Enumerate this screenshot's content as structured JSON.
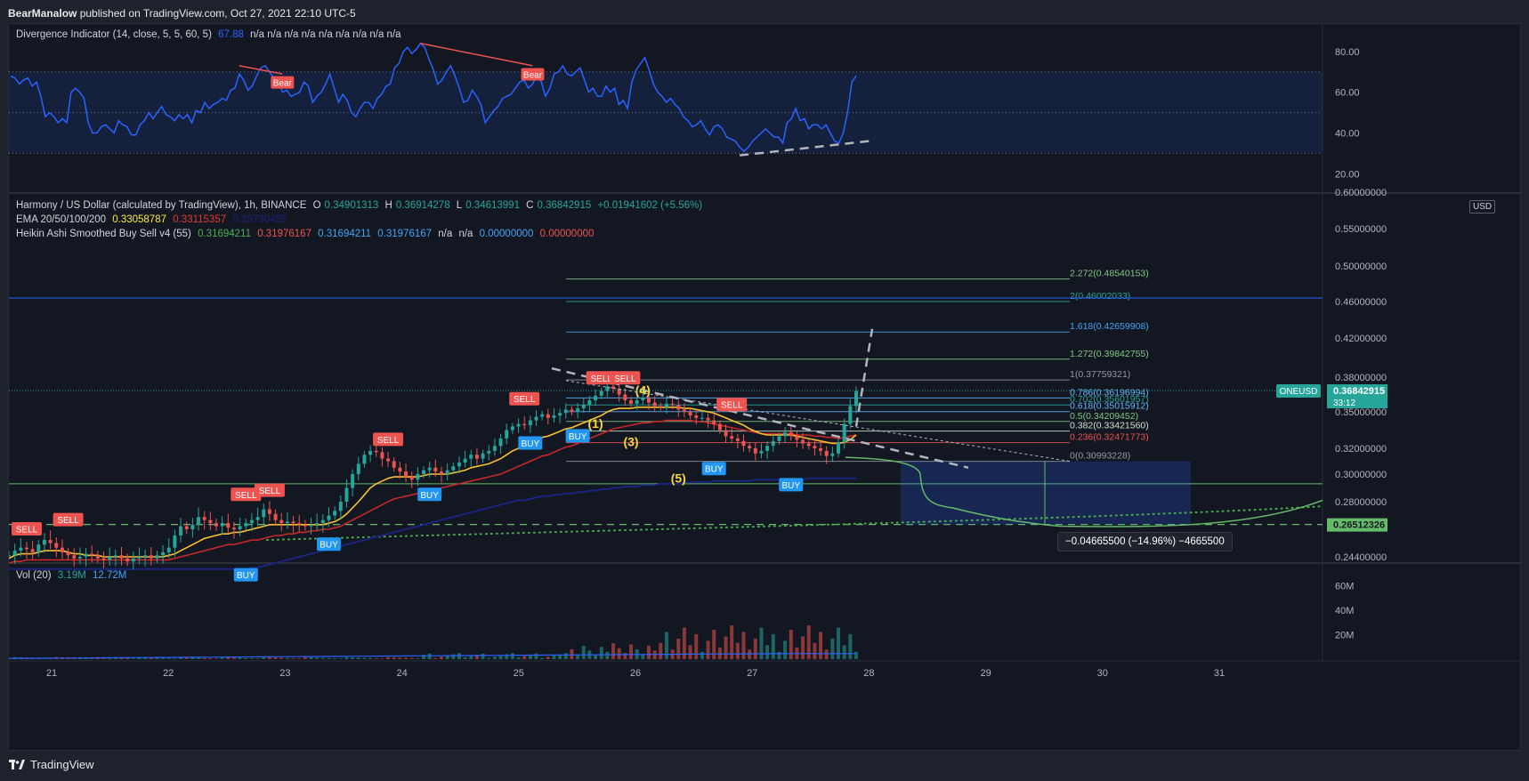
{
  "header": {
    "author": "BearManalow",
    "published": "published on TradingView.com, Oct 27, 2021 22:10 UTC-5"
  },
  "footer": {
    "brand": "TradingView"
  },
  "chart_data": [
    {
      "type": "line",
      "name": "Divergence Indicator",
      "legend": {
        "label": "Divergence Indicator (14, close, 5, 5, 60, 5)",
        "value": "67.88",
        "na": "n/a  n/a  n/a  n/a  n/a  n/a  n/a  n/a  n/a"
      },
      "y_ticks": [
        "80.00",
        "60.00",
        "40.00",
        "20.00"
      ],
      "ylim": [
        14,
        90
      ],
      "band": [
        30,
        70
      ],
      "midline": 50,
      "values": [
        68,
        67,
        64,
        66,
        67,
        63,
        65,
        58,
        48,
        50,
        48,
        45,
        47,
        45,
        60,
        62,
        60,
        57,
        45,
        40,
        40,
        43,
        44,
        42,
        40,
        46,
        44,
        43,
        39,
        39,
        44,
        46,
        50,
        47,
        50,
        53,
        49,
        48,
        46,
        49,
        47,
        49,
        45,
        51,
        50,
        55,
        52,
        54,
        55,
        57,
        56,
        61,
        62,
        69,
        66,
        61,
        63,
        68,
        72,
        73,
        70,
        67,
        66,
        60,
        61,
        58,
        59,
        60,
        65,
        63,
        55,
        58,
        60,
        64,
        69,
        62,
        55,
        59,
        56,
        50,
        48,
        52,
        55,
        55,
        52,
        57,
        59,
        63,
        64,
        72,
        74,
        80,
        82,
        79,
        81,
        84,
        82,
        76,
        71,
        64,
        66,
        70,
        73,
        68,
        62,
        55,
        56,
        61,
        58,
        54,
        45,
        48,
        51,
        53,
        57,
        58,
        59,
        62,
        65,
        66,
        62,
        64,
        69,
        65,
        58,
        62,
        69,
        70,
        73,
        69,
        68,
        70,
        72,
        66,
        60,
        62,
        58,
        58,
        63,
        60,
        62,
        54,
        56,
        52,
        65,
        71,
        74,
        77,
        71,
        64,
        60,
        58,
        55,
        57,
        54,
        52,
        48,
        46,
        43,
        44,
        46,
        42,
        39,
        43,
        44,
        42,
        38,
        37,
        36,
        33,
        31,
        33,
        36,
        38,
        40,
        42,
        40,
        38,
        38,
        35,
        45,
        47,
        52,
        46,
        47,
        42,
        44,
        44,
        42,
        44,
        40,
        36,
        35,
        40,
        50,
        65,
        68
      ],
      "annotations": [
        {
          "label": "Bear",
          "x_index": 63
        },
        {
          "label": "Bear",
          "x_index": 121
        }
      ]
    },
    {
      "type": "candlestick",
      "name": "Harmony / US Dollar",
      "legend": {
        "title": "Harmony / US Dollar (calculated by TradingView), 1h, BINANCE",
        "O": "0.34901313",
        "H": "0.36914278",
        "L": "0.34613991",
        "C": "0.36842915",
        "change": "+0.01941602 (+5.56%)",
        "ema_label": "EMA 20/50/100/200",
        "ema_values": [
          "0.33058787",
          "0.33115357",
          "0.28730455"
        ],
        "ha_label": "Heikin Ashi Smoothed Buy Sell v4  (55)",
        "ha_values": [
          "0.31694211",
          "0.31976167",
          "0.31694211",
          "0.31976167",
          "n/a",
          "n/a",
          "0.00000000",
          "0.00000000"
        ]
      },
      "y_ticks": [
        "0.60000000",
        "0.55000000",
        "0.50000000",
        "0.46000000",
        "0.42000000",
        "0.38000000",
        "0.35000000",
        "0.32000000",
        "0.30000000",
        "0.28000000",
        "0.24400000"
      ],
      "currency": "USD",
      "x_ticks": [
        "21",
        "22",
        "23",
        "24",
        "25",
        "26",
        "27",
        "28",
        "29",
        "30",
        "31"
      ],
      "last_price": {
        "symbol": "ONEUSD",
        "price": "0.36842915",
        "countdown": "33:12"
      },
      "target_price": "0.26512326",
      "close": [
        0.245,
        0.248,
        0.25,
        0.249,
        0.247,
        0.252,
        0.255,
        0.253,
        0.25,
        0.247,
        0.245,
        0.243,
        0.244,
        0.246,
        0.245,
        0.243,
        0.242,
        0.244,
        0.245,
        0.243,
        0.241,
        0.243,
        0.244,
        0.245,
        0.243,
        0.245,
        0.247,
        0.25,
        0.258,
        0.264,
        0.262,
        0.265,
        0.27,
        0.268,
        0.266,
        0.264,
        0.266,
        0.263,
        0.262,
        0.264,
        0.266,
        0.268,
        0.27,
        0.275,
        0.272,
        0.268,
        0.266,
        0.267,
        0.266,
        0.265,
        0.264,
        0.265,
        0.266,
        0.268,
        0.271,
        0.274,
        0.28,
        0.29,
        0.3,
        0.308,
        0.315,
        0.318,
        0.317,
        0.312,
        0.31,
        0.305,
        0.302,
        0.298,
        0.296,
        0.3,
        0.303,
        0.305,
        0.302,
        0.3,
        0.303,
        0.306,
        0.309,
        0.312,
        0.315,
        0.312,
        0.316,
        0.318,
        0.322,
        0.328,
        0.335,
        0.338,
        0.34,
        0.339,
        0.343,
        0.346,
        0.348,
        0.345,
        0.347,
        0.349,
        0.352,
        0.35,
        0.353,
        0.356,
        0.36,
        0.364,
        0.368,
        0.372,
        0.37,
        0.365,
        0.36,
        0.357,
        0.36,
        0.362,
        0.358,
        0.355,
        0.354,
        0.357,
        0.356,
        0.352,
        0.35,
        0.347,
        0.345,
        0.345,
        0.343,
        0.34,
        0.335,
        0.33,
        0.328,
        0.326,
        0.322,
        0.32,
        0.316,
        0.318,
        0.322,
        0.326,
        0.33,
        0.333,
        0.33,
        0.327,
        0.324,
        0.322,
        0.32,
        0.318,
        0.314,
        0.316,
        0.325,
        0.34,
        0.355,
        0.368
      ],
      "ema_fast": [
        0.243,
        0.245,
        0.246,
        0.246,
        0.246,
        0.247,
        0.248,
        0.248,
        0.248,
        0.248,
        0.247,
        0.246,
        0.246,
        0.245,
        0.245,
        0.245,
        0.244,
        0.244,
        0.244,
        0.244,
        0.244,
        0.244,
        0.244,
        0.244,
        0.244,
        0.244,
        0.244,
        0.245,
        0.246,
        0.248,
        0.25,
        0.252,
        0.254,
        0.256,
        0.257,
        0.258,
        0.259,
        0.259,
        0.26,
        0.26,
        0.261,
        0.262,
        0.263,
        0.264,
        0.265,
        0.265,
        0.265,
        0.265,
        0.265,
        0.265,
        0.265,
        0.265,
        0.265,
        0.265,
        0.266,
        0.267,
        0.269,
        0.272,
        0.276,
        0.28,
        0.285,
        0.29,
        0.293,
        0.295,
        0.297,
        0.298,
        0.298,
        0.298,
        0.298,
        0.298,
        0.299,
        0.3,
        0.3,
        0.3,
        0.3,
        0.301,
        0.302,
        0.303,
        0.305,
        0.306,
        0.307,
        0.308,
        0.31,
        0.312,
        0.315,
        0.318,
        0.32,
        0.322,
        0.324,
        0.327,
        0.329,
        0.33,
        0.332,
        0.334,
        0.336,
        0.337,
        0.339,
        0.341,
        0.343,
        0.345,
        0.347,
        0.35,
        0.352,
        0.353,
        0.353,
        0.353,
        0.354,
        0.354,
        0.354,
        0.354,
        0.354,
        0.354,
        0.354,
        0.354,
        0.353,
        0.353,
        0.352,
        0.351,
        0.35,
        0.349,
        0.347,
        0.345,
        0.343,
        0.341,
        0.339,
        0.336,
        0.334,
        0.332,
        0.331,
        0.331,
        0.331,
        0.331,
        0.331,
        0.33,
        0.329,
        0.328,
        0.327,
        0.326,
        0.325,
        0.324,
        0.324,
        0.325,
        0.327,
        0.331
      ],
      "ema_mid": [
        0.24,
        0.241,
        0.241,
        0.242,
        0.242,
        0.242,
        0.242,
        0.242,
        0.242,
        0.242,
        0.242,
        0.242,
        0.242,
        0.242,
        0.242,
        0.242,
        0.242,
        0.242,
        0.242,
        0.242,
        0.242,
        0.242,
        0.242,
        0.242,
        0.242,
        0.242,
        0.242,
        0.242,
        0.243,
        0.244,
        0.245,
        0.246,
        0.247,
        0.248,
        0.249,
        0.25,
        0.251,
        0.252,
        0.252,
        0.253,
        0.254,
        0.255,
        0.255,
        0.256,
        0.257,
        0.258,
        0.258,
        0.259,
        0.259,
        0.26,
        0.26,
        0.261,
        0.261,
        0.262,
        0.262,
        0.263,
        0.264,
        0.266,
        0.268,
        0.27,
        0.272,
        0.274,
        0.276,
        0.278,
        0.28,
        0.282,
        0.283,
        0.284,
        0.285,
        0.286,
        0.287,
        0.288,
        0.289,
        0.29,
        0.291,
        0.292,
        0.293,
        0.294,
        0.295,
        0.296,
        0.297,
        0.298,
        0.299,
        0.3,
        0.302,
        0.304,
        0.306,
        0.308,
        0.31,
        0.312,
        0.314,
        0.315,
        0.317,
        0.319,
        0.321,
        0.322,
        0.324,
        0.326,
        0.328,
        0.33,
        0.332,
        0.334,
        0.336,
        0.337,
        0.338,
        0.339,
        0.34,
        0.341,
        0.341,
        0.342,
        0.342,
        0.343,
        0.343,
        0.343,
        0.343,
        0.343,
        0.342,
        0.342,
        0.341,
        0.34,
        0.339,
        0.338,
        0.337,
        0.336,
        0.335,
        0.334,
        0.333,
        0.332,
        0.332,
        0.332,
        0.332,
        0.332,
        0.332,
        0.331,
        0.331,
        0.331,
        0.33,
        0.33,
        0.329,
        0.329,
        0.328,
        0.329,
        0.33,
        0.331
      ],
      "ema_slow": [
        0.236,
        0.236,
        0.236,
        0.236,
        0.236,
        0.236,
        0.236,
        0.236,
        0.236,
        0.236,
        0.236,
        0.236,
        0.236,
        0.236,
        0.236,
        0.236,
        0.236,
        0.236,
        0.236,
        0.236,
        0.236,
        0.236,
        0.236,
        0.236,
        0.236,
        0.236,
        0.236,
        0.236,
        0.236,
        0.236,
        0.236,
        0.236,
        0.236,
        0.236,
        0.236,
        0.236,
        0.236,
        0.236,
        0.236,
        0.236,
        0.236,
        0.237,
        0.237,
        0.238,
        0.239,
        0.24,
        0.241,
        0.242,
        0.243,
        0.244,
        0.245,
        0.246,
        0.247,
        0.248,
        0.249,
        0.25,
        0.251,
        0.252,
        0.253,
        0.254,
        0.255,
        0.256,
        0.257,
        0.258,
        0.259,
        0.26,
        0.261,
        0.262,
        0.263,
        0.264,
        0.265,
        0.266,
        0.267,
        0.268,
        0.269,
        0.27,
        0.271,
        0.272,
        0.273,
        0.274,
        0.275,
        0.276,
        0.277,
        0.278,
        0.279,
        0.28,
        0.281,
        0.281,
        0.282,
        0.283,
        0.284,
        0.284,
        0.285,
        0.285,
        0.286,
        0.286,
        0.287,
        0.287,
        0.288,
        0.288,
        0.289,
        0.289,
        0.29,
        0.29,
        0.291,
        0.291,
        0.291,
        0.292,
        0.292,
        0.292,
        0.293,
        0.293,
        0.293,
        0.293,
        0.294,
        0.294,
        0.294,
        0.294,
        0.294,
        0.295,
        0.295,
        0.295,
        0.295,
        0.295,
        0.295,
        0.295,
        0.296,
        0.296,
        0.296,
        0.296,
        0.296,
        0.296,
        0.296,
        0.296,
        0.296,
        0.297,
        0.297,
        0.297,
        0.297,
        0.297,
        0.297,
        0.297,
        0.297,
        0.297
      ],
      "fib_levels": [
        {
          "label": "2.272(0.48540153)",
          "value": 0.4854,
          "color": "#81c784"
        },
        {
          "label": "2(0.46002033)",
          "value": 0.46,
          "color": "#26a69a"
        },
        {
          "label": "1.618(0.42659908)",
          "value": 0.4266,
          "color": "#42a5f5"
        },
        {
          "label": "1.272(0.39842755)",
          "value": 0.3984,
          "color": "#81c784"
        },
        {
          "label": "1(0.37759321)",
          "value": 0.3776,
          "color": "#9598a1"
        },
        {
          "label": "0.786(0.36196994)",
          "value": 0.362,
          "color": "#64b5f6"
        },
        {
          "label": "0.702(0.35601957)",
          "value": 0.356,
          "color": "#26a69a"
        },
        {
          "label": "0.618(0.35015912)",
          "value": 0.3502,
          "color": "#64b5f6"
        },
        {
          "label": "0.5(0.34209452)",
          "value": 0.3421,
          "color": "#81c784"
        },
        {
          "label": "0.382(0.33421560)",
          "value": 0.3342,
          "color": "#c8e6c9"
        },
        {
          "label": "0.236(0.32471773)",
          "value": 0.3247,
          "color": "#ef5350"
        },
        {
          "label": "0(0.30993228)",
          "value": 0.3099,
          "color": "#9598a1"
        }
      ],
      "horizontal_lines": [
        {
          "value": 0.464,
          "color": "#2962ff"
        },
        {
          "value": 0.293,
          "color": "#66bb6a"
        }
      ],
      "signals": [
        {
          "label": "SELL",
          "kind": "sell",
          "x_index": 3,
          "price": 0.262
        },
        {
          "label": "SELL",
          "kind": "sell",
          "x_index": 10,
          "price": 0.268
        },
        {
          "label": "SELL",
          "kind": "sell",
          "x_index": 40,
          "price": 0.285
        },
        {
          "label": "SELL",
          "kind": "sell",
          "x_index": 44,
          "price": 0.288
        },
        {
          "label": "BUY",
          "kind": "buy",
          "x_index": 40,
          "price": 0.232
        },
        {
          "label": "BUY",
          "kind": "buy",
          "x_index": 54,
          "price": 0.252
        },
        {
          "label": "SELL",
          "kind": "sell",
          "x_index": 64,
          "price": 0.327
        },
        {
          "label": "BUY",
          "kind": "buy",
          "x_index": 71,
          "price": 0.285
        },
        {
          "label": "BUY",
          "kind": "buy",
          "x_index": 88,
          "price": 0.324
        },
        {
          "label": "SELL",
          "kind": "sell",
          "x_index": 87,
          "price": 0.361
        },
        {
          "label": "SELL",
          "kind": "sell",
          "x_index": 100,
          "price": 0.379
        },
        {
          "label": "SELL",
          "kind": "sell",
          "x_index": 104,
          "price": 0.379
        },
        {
          "label": "BUY",
          "kind": "buy",
          "x_index": 96,
          "price": 0.33
        },
        {
          "label": "SELL",
          "kind": "sell",
          "x_index": 122,
          "price": 0.356
        },
        {
          "label": "BUY",
          "kind": "buy",
          "x_index": 119,
          "price": 0.304
        },
        {
          "label": "BUY",
          "kind": "buy",
          "x_index": 132,
          "price": 0.292
        }
      ],
      "wave_labels": [
        {
          "label": "(1)",
          "x_index": 99,
          "price": 0.337
        },
        {
          "label": "(3)",
          "x_index": 105,
          "price": 0.322
        },
        {
          "label": "(4)",
          "x_index": 107,
          "price": 0.365
        },
        {
          "label": "(5)",
          "x_index": 113,
          "price": 0.294
        }
      ],
      "measure": {
        "label": "−0.04665500 (−14.96%) −4665500"
      }
    },
    {
      "type": "bar",
      "name": "Vol (20)",
      "legend": {
        "label": "Vol (20)",
        "v1": "3.19M",
        "v2": "12.72M"
      },
      "y_ticks": [
        "60M",
        "40M",
        "20M"
      ],
      "ylim": [
        0,
        72
      ]
    }
  ]
}
